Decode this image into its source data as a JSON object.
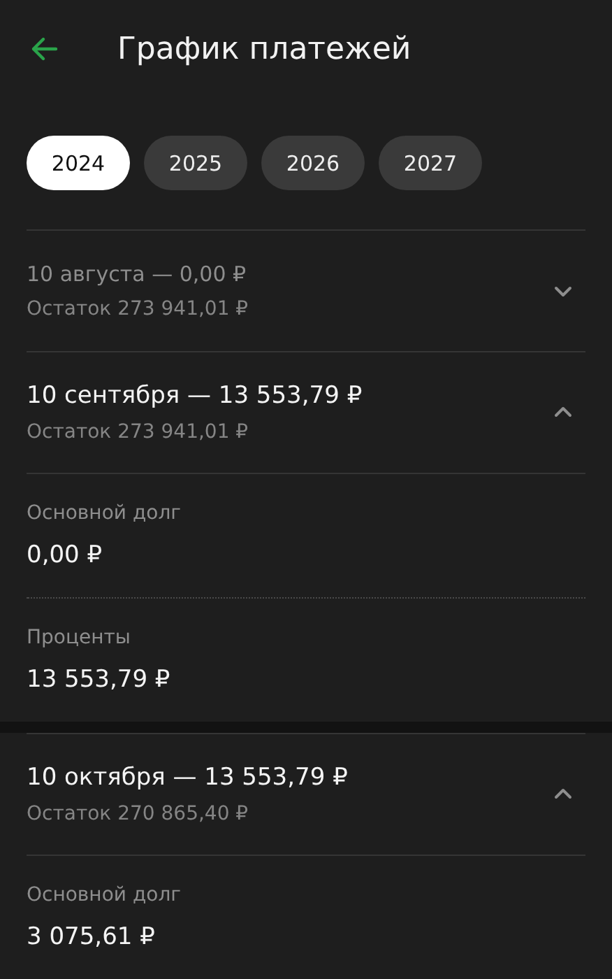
{
  "header": {
    "title": "График платежей"
  },
  "years": [
    {
      "label": "2024",
      "selected": true
    },
    {
      "label": "2025",
      "selected": false
    },
    {
      "label": "2026",
      "selected": false
    },
    {
      "label": "2027",
      "selected": false
    }
  ],
  "payments": [
    {
      "title": "10 августа — 0,00 ₽",
      "balance": "Остаток 273 941,01 ₽",
      "expanded": false
    },
    {
      "title": "10 сентября — 13 553,79 ₽",
      "balance": "Остаток 273 941,01 ₽",
      "expanded": true,
      "details": [
        {
          "label": "Основной долг",
          "value": "0,00 ₽"
        },
        {
          "label": "Проценты",
          "value": "13 553,79 ₽"
        }
      ]
    },
    {
      "title": "10 октября — 13 553,79 ₽",
      "balance": "Остаток 270 865,40 ₽",
      "expanded": true,
      "details": [
        {
          "label": "Основной долг",
          "value": "3 075,61 ₽"
        }
      ]
    }
  ]
}
